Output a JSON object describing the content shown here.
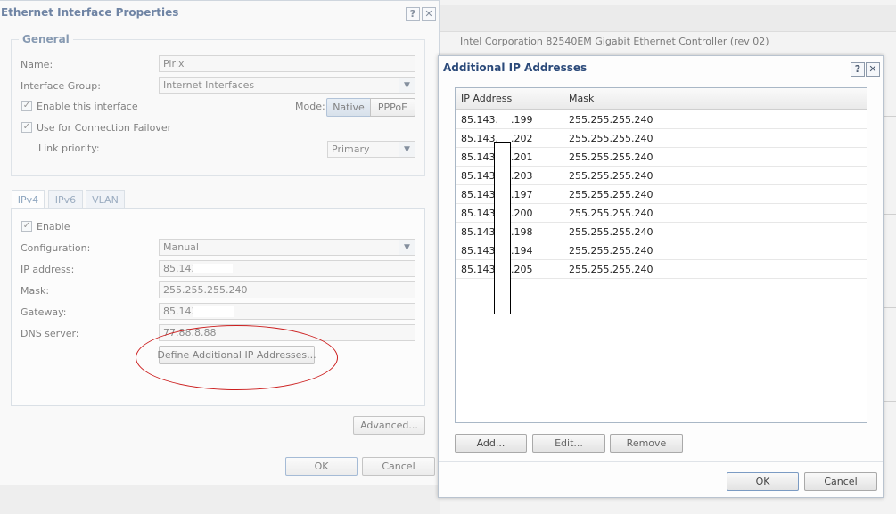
{
  "background": {
    "device_name": "Intel Corporation 82540EM Gigabit Ethernet Controller (rev 02)"
  },
  "eth_dialog": {
    "title": "Ethernet Interface Properties",
    "help_btn": "?",
    "close_btn": "✕",
    "general": {
      "legend": "General",
      "name_label": "Name:",
      "name_value": "Pirix",
      "group_label": "Interface Group:",
      "group_value": "Internet Interfaces",
      "enable_iface_label": "Enable this interface",
      "mode_label": "Mode:",
      "mode_native": "Native",
      "mode_pppoe": "PPPoE",
      "failover_label": "Use for Connection Failover",
      "link_priority_label": "Link priority:",
      "link_priority_value": "Primary"
    },
    "tabs": [
      "IPv4",
      "IPv6",
      "VLAN"
    ],
    "ipv4": {
      "enable_label": "Enable",
      "config_label": "Configuration:",
      "config_value": "Manual",
      "ip_label": "IP address:",
      "ip_value": "85.143.",
      "mask_label": "Mask:",
      "mask_value": "255.255.255.240",
      "gateway_label": "Gateway:",
      "gateway_value": "85.143.",
      "dns_label": "DNS server:",
      "dns_value": "77.88.8.88",
      "define_btn": "Define Additional IP Addresses..."
    },
    "advanced_btn": "Advanced...",
    "ok_btn": "OK",
    "cancel_btn": "Cancel"
  },
  "addr_dialog": {
    "title": "Additional IP Addresses",
    "help_btn": "?",
    "close_btn": "✕",
    "columns": [
      "IP Address",
      "Mask"
    ],
    "rows": [
      {
        "ip_prefix": "85.143.",
        "ip_suffix": ".199",
        "mask": "255.255.255.240"
      },
      {
        "ip_prefix": "85.143.",
        "ip_suffix": ".202",
        "mask": "255.255.255.240"
      },
      {
        "ip_prefix": "85.143.",
        "ip_suffix": ".201",
        "mask": "255.255.255.240"
      },
      {
        "ip_prefix": "85.143.",
        "ip_suffix": ".203",
        "mask": "255.255.255.240"
      },
      {
        "ip_prefix": "85.143.",
        "ip_suffix": ".197",
        "mask": "255.255.255.240"
      },
      {
        "ip_prefix": "85.143.",
        "ip_suffix": ".200",
        "mask": "255.255.255.240"
      },
      {
        "ip_prefix": "85.143.",
        "ip_suffix": ".198",
        "mask": "255.255.255.240"
      },
      {
        "ip_prefix": "85.143.",
        "ip_suffix": ".194",
        "mask": "255.255.255.240"
      },
      {
        "ip_prefix": "85.143.",
        "ip_suffix": ".205",
        "mask": "255.255.255.240"
      }
    ],
    "add_btn": "Add...",
    "edit_btn": "Edit...",
    "remove_btn": "Remove",
    "ok_btn": "OK",
    "cancel_btn": "Cancel"
  }
}
